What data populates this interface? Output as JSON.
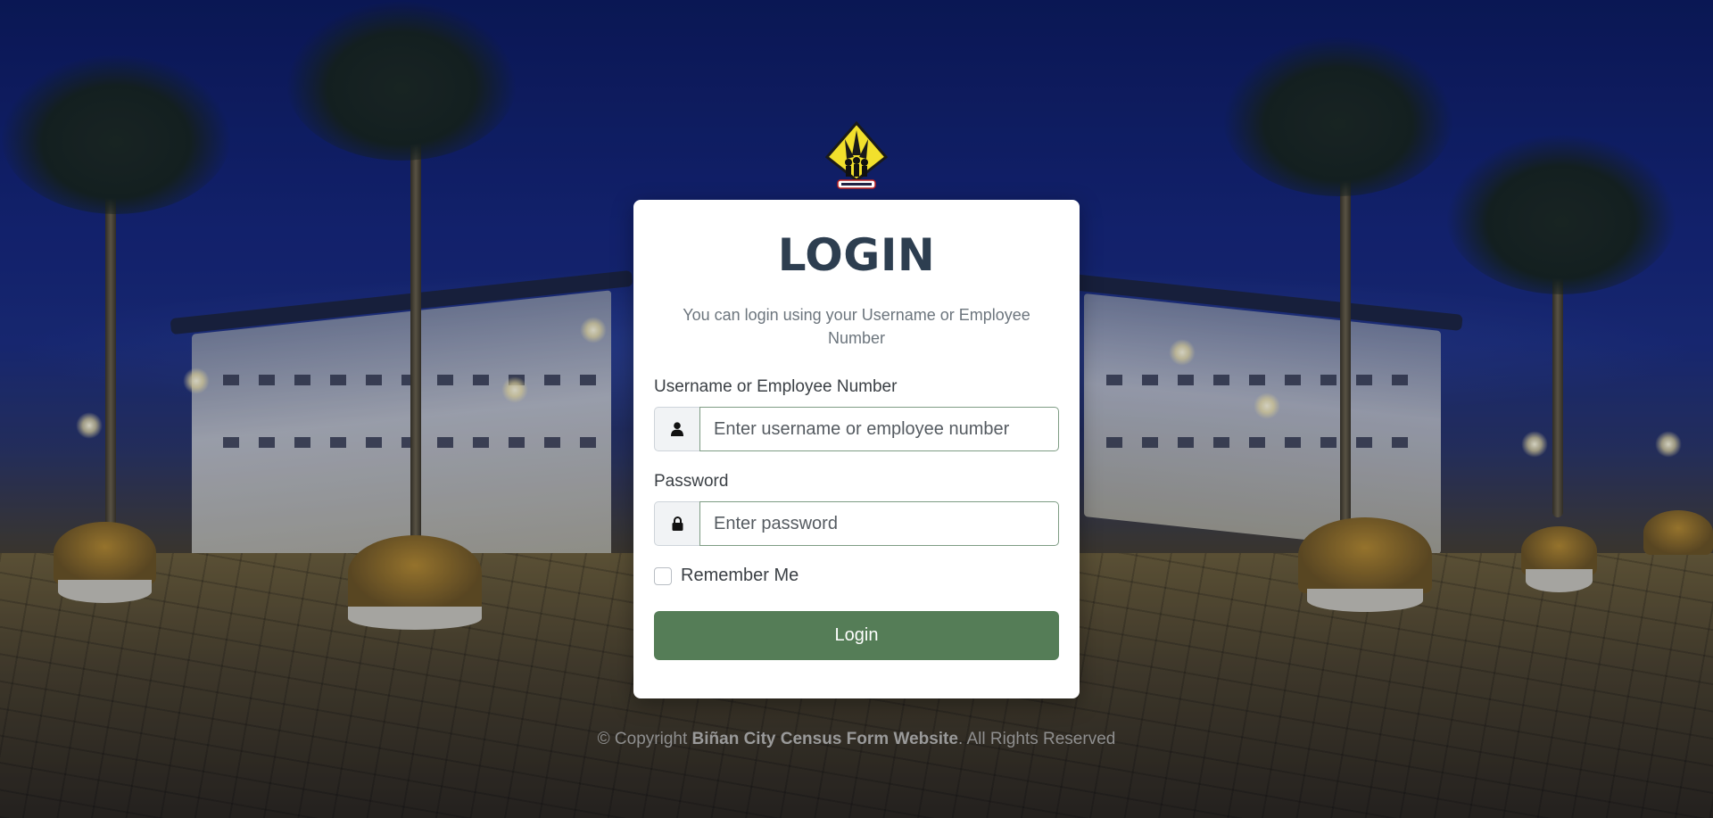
{
  "logo": {
    "icon": "census-logo"
  },
  "card": {
    "title": "LOGIN",
    "subtitle": "You can login using your Username or Employee Number",
    "username": {
      "label": "Username or Employee Number",
      "placeholder": "Enter username or employee number",
      "value": "",
      "icon": "user-icon"
    },
    "password": {
      "label": "Password",
      "placeholder": "Enter password",
      "value": "",
      "icon": "lock-icon"
    },
    "remember_label": "Remember Me",
    "remember_checked": false,
    "login_label": "Login"
  },
  "footer": {
    "prefix": "© Copyright ",
    "site_name": "Biñan City Census Form Website",
    "suffix": ". All Rights Reserved"
  },
  "colors": {
    "primary_button": "#557d57",
    "title": "#2d3e50",
    "input_border": "#7e9c84"
  }
}
